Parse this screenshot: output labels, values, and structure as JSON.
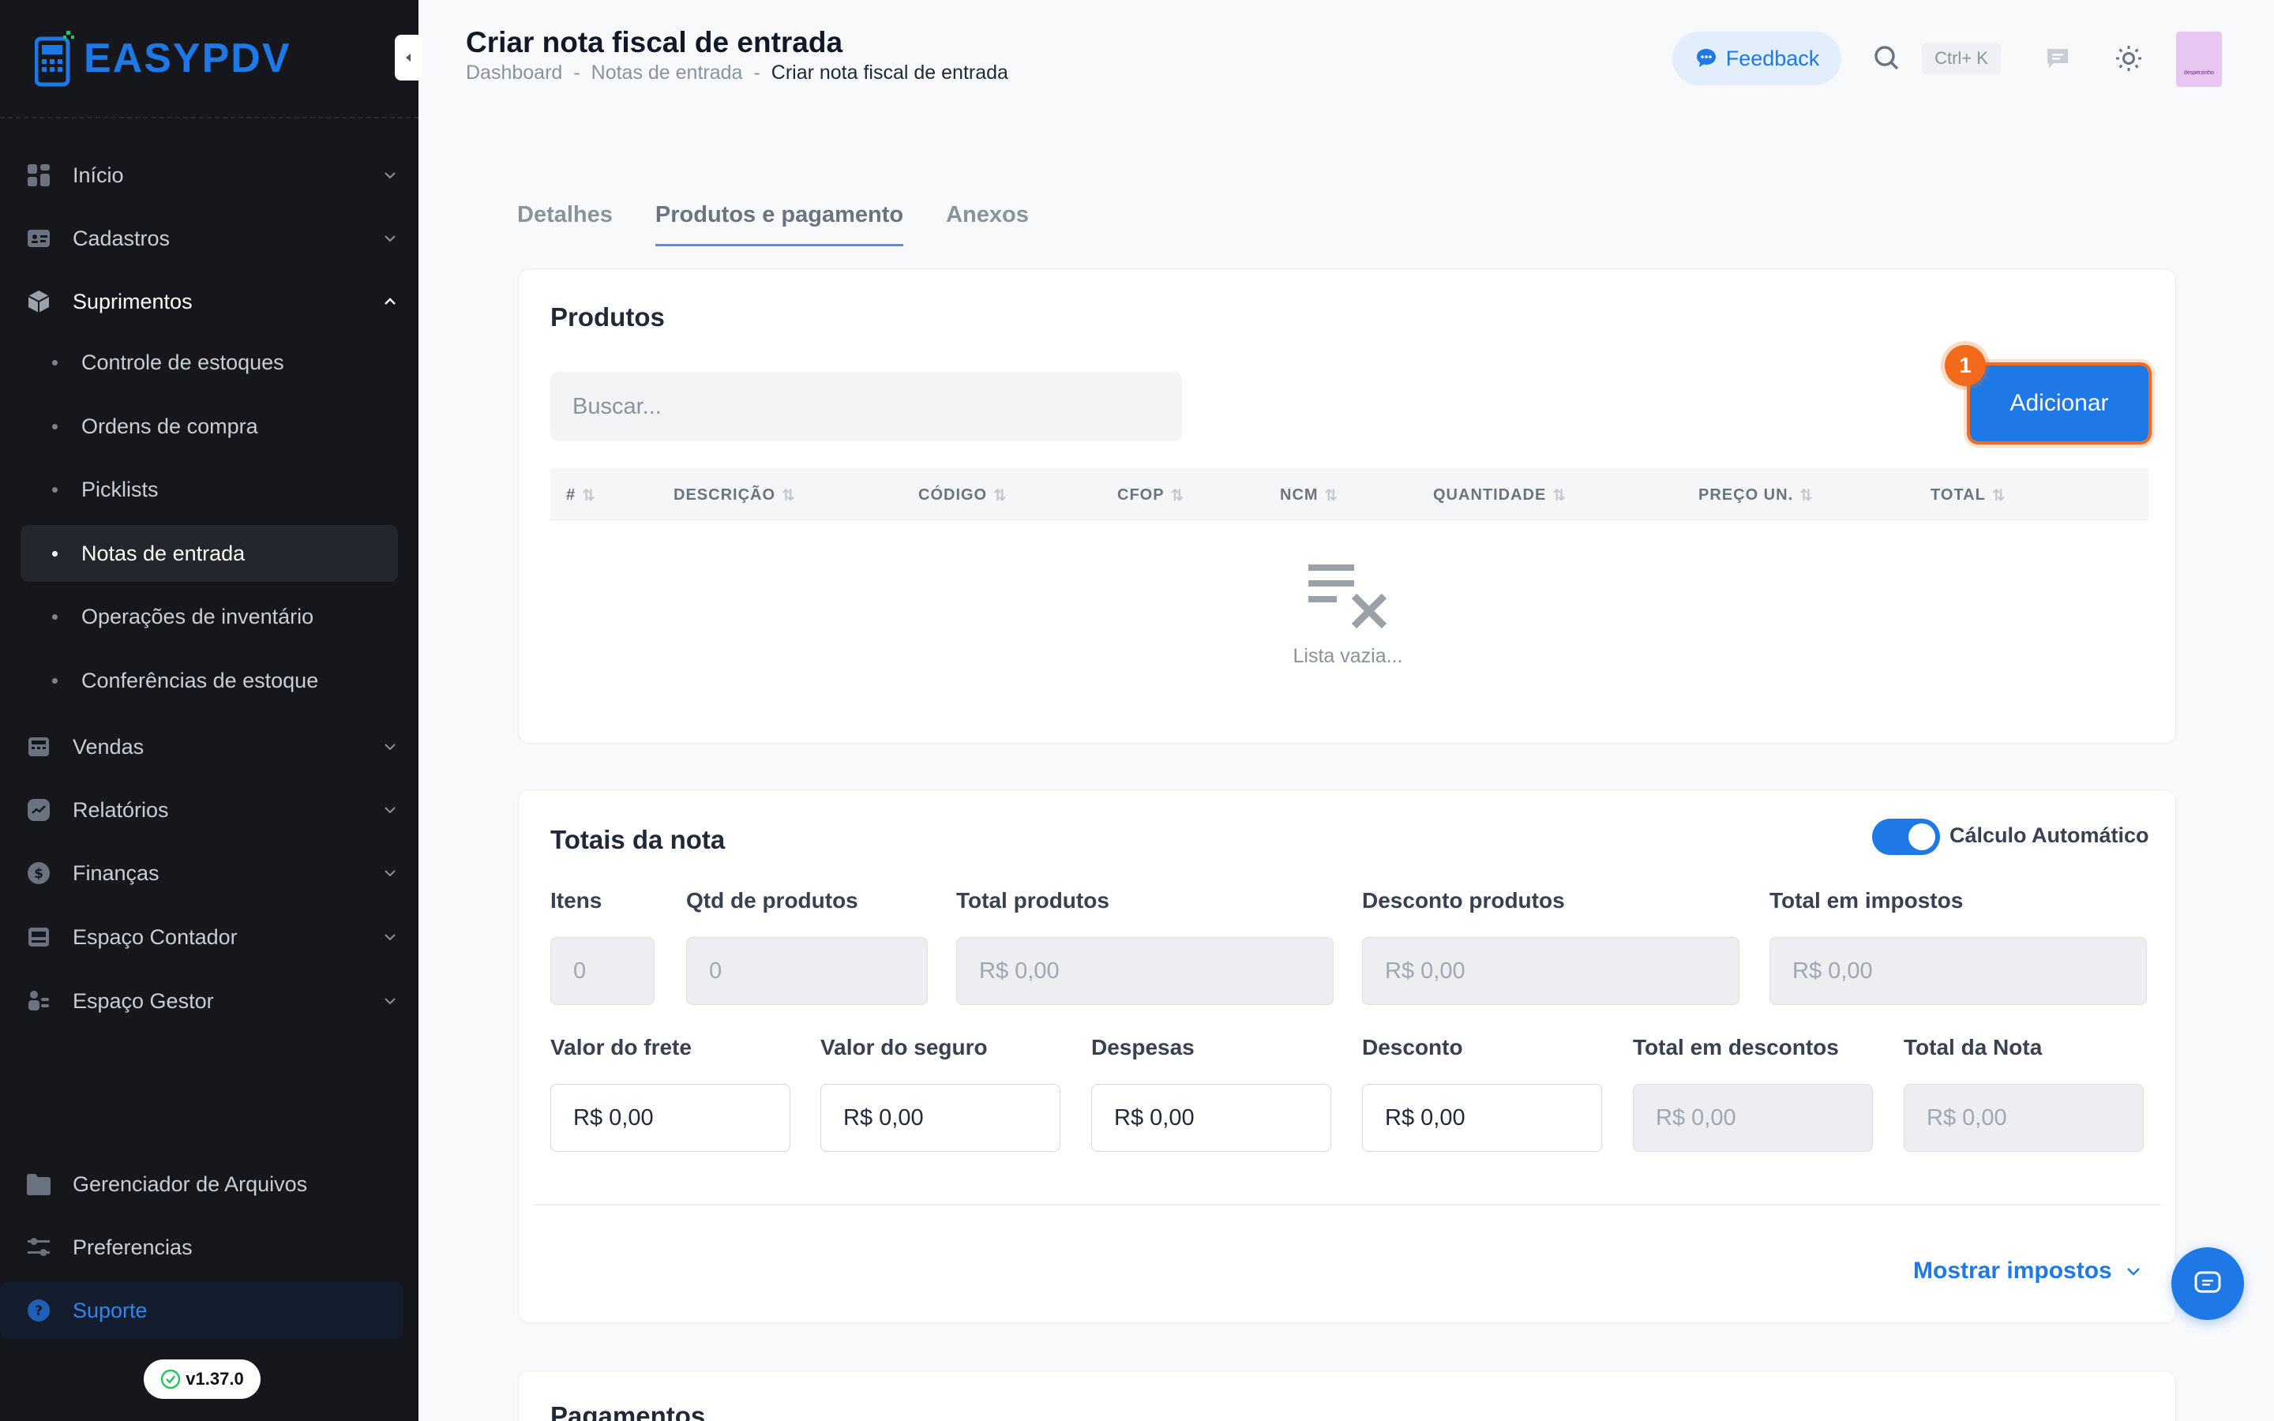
{
  "app": {
    "brand": "EASYPDV",
    "version": "v1.37.0",
    "colors": {
      "accent": "#1e78e6",
      "sidebar_bg": "#15171c",
      "highlight": "#f26a1b"
    }
  },
  "sidebar": {
    "items": [
      {
        "label": "Início",
        "icon": "grid-icon"
      },
      {
        "label": "Cadastros",
        "icon": "id-card-icon"
      },
      {
        "label": "Suprimentos",
        "icon": "box-icon"
      }
    ],
    "sub_items": [
      {
        "label": "Controle de estoques"
      },
      {
        "label": "Ordens de compra"
      },
      {
        "label": "Picklists"
      },
      {
        "label": "Notas de entrada",
        "active": true
      },
      {
        "label": "Operações de inventário"
      },
      {
        "label": "Conferências de estoque"
      }
    ],
    "items_after": [
      {
        "label": "Vendas",
        "icon": "register-icon"
      },
      {
        "label": "Relatórios",
        "icon": "chart-icon"
      },
      {
        "label": "Finanças",
        "icon": "dollar-icon"
      },
      {
        "label": "Espaço Contador",
        "icon": "desk-icon"
      },
      {
        "label": "Espaço Gestor",
        "icon": "manager-icon"
      }
    ],
    "bottom": [
      {
        "label": "Gerenciador de Arquivos",
        "icon": "folder-icon"
      },
      {
        "label": "Preferencias",
        "icon": "sliders-icon"
      },
      {
        "label": "Suporte",
        "icon": "help-icon"
      }
    ]
  },
  "header": {
    "title": "Criar nota fiscal de entrada",
    "breadcrumb": [
      "Dashboard",
      "Notas de entrada",
      "Criar nota fiscal de entrada"
    ],
    "breadcrumb_sep": "-",
    "feedback_label": "Feedback",
    "search_shortcut": "Ctrl+ K",
    "avatar_text": "desperzinho"
  },
  "tabs": [
    {
      "label": "Detalhes"
    },
    {
      "label": "Produtos e pagamento",
      "active": true
    },
    {
      "label": "Anexos"
    }
  ],
  "products": {
    "title": "Produtos",
    "search_placeholder": "Buscar...",
    "add_label": "Adicionar",
    "step_badge": "1",
    "columns": [
      "#",
      "DESCRIÇÃO",
      "CÓDIGO",
      "CFOP",
      "NCM",
      "QUANTIDADE",
      "PREÇO UN.",
      "TOTAL"
    ],
    "empty_text": "Lista vazia..."
  },
  "totals": {
    "title": "Totais da nota",
    "auto_calc_label": "Cálculo Automático",
    "auto_calc_on": true,
    "row1": [
      {
        "label": "Itens",
        "value": "0",
        "readonly": true
      },
      {
        "label": "Qtd de produtos",
        "value": "0",
        "readonly": true
      },
      {
        "label": "Total produtos",
        "value": "R$ 0,00",
        "readonly": true
      },
      {
        "label": "Desconto produtos",
        "value": "R$ 0,00",
        "readonly": true
      },
      {
        "label": "Total em impostos",
        "value": "R$ 0,00",
        "readonly": true
      }
    ],
    "row2": [
      {
        "label": "Valor do frete",
        "value": "R$ 0,00",
        "readonly": false
      },
      {
        "label": "Valor do seguro",
        "value": "R$ 0,00",
        "readonly": false
      },
      {
        "label": "Despesas",
        "value": "R$ 0,00",
        "readonly": false
      },
      {
        "label": "Desconto",
        "value": "R$ 0,00",
        "readonly": false
      },
      {
        "label": "Total em descontos",
        "value": "R$ 0,00",
        "readonly": true
      },
      {
        "label": "Total da Nota",
        "value": "R$ 0,00",
        "readonly": true
      }
    ],
    "show_taxes_label": "Mostrar impostos"
  },
  "payments": {
    "title": "Pagamentos"
  }
}
